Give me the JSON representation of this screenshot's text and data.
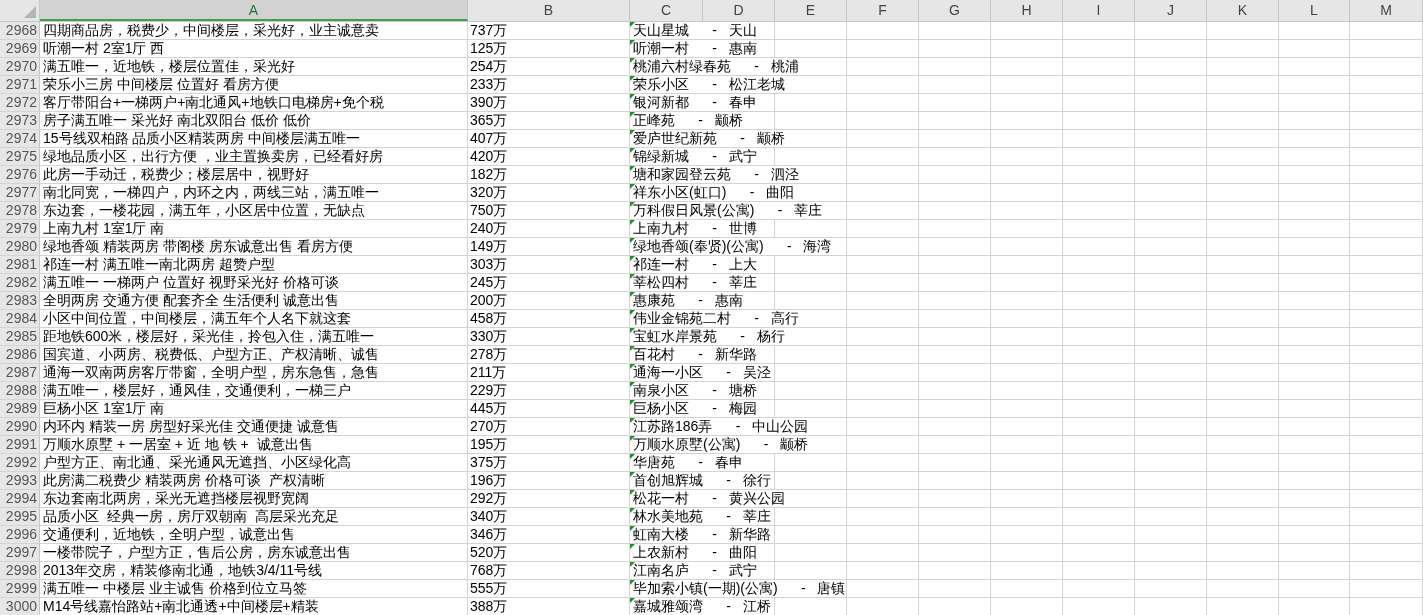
{
  "columns": [
    {
      "label": "A",
      "selected": true
    },
    {
      "label": "B",
      "selected": false
    },
    {
      "label": "C",
      "selected": false
    },
    {
      "label": "D",
      "selected": false
    },
    {
      "label": "E",
      "selected": false
    },
    {
      "label": "F",
      "selected": false
    },
    {
      "label": "G",
      "selected": false
    },
    {
      "label": "H",
      "selected": false
    },
    {
      "label": "I",
      "selected": false
    },
    {
      "label": "J",
      "selected": false
    },
    {
      "label": "K",
      "selected": false
    },
    {
      "label": "L",
      "selected": false
    },
    {
      "label": "M",
      "selected": false
    }
  ],
  "rows": [
    {
      "number": "2968",
      "a": "四期商品房，税费少，中间楼层，采光好，业主诚意卖",
      "b": "737万",
      "c": "天山星城      -   天山"
    },
    {
      "number": "2969",
      "a": "听潮一村 2室1厅 西",
      "b": "125万",
      "c": "听潮一村      -   惠南"
    },
    {
      "number": "2970",
      "a": "满五唯一，近地铁，楼层位置佳，采光好",
      "b": "254万",
      "c": "桃浦六村绿春苑      -   桃浦"
    },
    {
      "number": "2971",
      "a": "荣乐小三房 中间楼层 位置好 看房方便",
      "b": "233万",
      "c": "荣乐小区      -   松江老城"
    },
    {
      "number": "2972",
      "a": "客厅带阳台+一梯两户+南北通风+地铁口电梯房+免个税",
      "b": "390万",
      "c": "银河新都      -   春申"
    },
    {
      "number": "2973",
      "a": "房子满五唯一 采光好 南北双阳台 低价 低价",
      "b": "365万",
      "c": "正峰苑      -   颛桥"
    },
    {
      "number": "2974",
      "a": "15号线双柏路 品质小区精装两房 中间楼层满五唯一",
      "b": "407万",
      "c": "爱庐世纪新苑      -   颛桥"
    },
    {
      "number": "2975",
      "a": "绿地品质小区，出行方便 ，业主置换卖房，已经看好房",
      "b": "420万",
      "c": "锦绿新城      -   武宁"
    },
    {
      "number": "2976",
      "a": "此房一手动迁，税费少；楼层居中，视野好",
      "b": "182万",
      "c": "塘和家园登云苑      -   泗泾"
    },
    {
      "number": "2977",
      "a": "南北同宽，一梯四户，内环之内，两线三站，满五唯一",
      "b": "320万",
      "c": "祥东小区(虹口)      -   曲阳"
    },
    {
      "number": "2978",
      "a": "东边套，一楼花园，满五年，小区居中位置，无缺点",
      "b": "750万",
      "c": "万科假日风景(公寓)      -   莘庄"
    },
    {
      "number": "2979",
      "a": "上南九村 1室1厅 南",
      "b": "240万",
      "c": "上南九村      -   世博"
    },
    {
      "number": "2980",
      "a": "绿地香颂 精装两房 带阁楼 房东诚意出售 看房方便",
      "b": "149万",
      "c": "绿地香颂(奉贤)(公寓)      -   海湾"
    },
    {
      "number": "2981",
      "a": "祁连一村 满五唯一南北两房 超赞户型",
      "b": "303万",
      "c": "祁连一村      -   上大"
    },
    {
      "number": "2982",
      "a": "满五唯一 一梯两户 位置好 视野采光好 价格可谈",
      "b": "245万",
      "c": "莘松四村      -   莘庄"
    },
    {
      "number": "2983",
      "a": "全明两房 交通方便 配套齐全 生活便利 诚意出售",
      "b": "200万",
      "c": "惠康苑      -   惠南"
    },
    {
      "number": "2984",
      "a": "小区中间位置，中间楼层，满五年个人名下就这套",
      "b": "458万",
      "c": "伟业金锦苑二村      -   高行"
    },
    {
      "number": "2985",
      "a": "距地铁600米，楼层好，采光佳，拎包入住，满五唯一",
      "b": "330万",
      "c": "宝虹水岸景苑      -   杨行"
    },
    {
      "number": "2986",
      "a": "国宾道、小两房、税费低、户型方正、产权清晰、诚售",
      "b": "278万",
      "c": "百花村      -   新华路"
    },
    {
      "number": "2987",
      "a": "通海一双南两房客厅带窗，全明户型，房东急售，急售",
      "b": "211万",
      "c": "通海一小区      -   吴泾"
    },
    {
      "number": "2988",
      "a": "满五唯一，楼层好，通风佳，交通便利，一梯三户",
      "b": "229万",
      "c": "南泉小区      -   塘桥"
    },
    {
      "number": "2989",
      "a": "巨杨小区 1室1厅 南",
      "b": "445万",
      "c": "巨杨小区      -   梅园"
    },
    {
      "number": "2990",
      "a": "内环内 精装一房 房型好采光佳 交通便捷 诚意售",
      "b": "270万",
      "c": "江苏路186弄      -   中山公园"
    },
    {
      "number": "2991",
      "a": "万顺水原墅 + 一居室 + 近 地 铁 +  诚意出售",
      "b": "195万",
      "c": "万顺水原墅(公寓)      -   颛桥"
    },
    {
      "number": "2992",
      "a": "户型方正、南北通、采光通风无遮挡、小区绿化高",
      "b": "375万",
      "c": "华唐苑      -   春申"
    },
    {
      "number": "2993",
      "a": "此房满二税费少 精装两房 价格可谈  产权清晰",
      "b": "196万",
      "c": "首创旭辉城      -   徐行"
    },
    {
      "number": "2994",
      "a": "东边套南北两房，采光无遮挡楼层视野宽阔",
      "b": "292万",
      "c": "松花一村      -   黄兴公园"
    },
    {
      "number": "2995",
      "a": "品质小区  经典一房，房厅双朝南  高层采光充足",
      "b": "340万",
      "c": "林水美地苑      -   莘庄"
    },
    {
      "number": "2996",
      "a": "交通便利，近地铁，全明户型，诚意出售",
      "b": "346万",
      "c": "虹南大楼      -   新华路"
    },
    {
      "number": "2997",
      "a": "一楼带院子，户型方正，售后公房，房东诚意出售",
      "b": "520万",
      "c": "上农新村      -   曲阳"
    },
    {
      "number": "2998",
      "a": "2013年交房，精装修南北通，地铁3/4/11号线",
      "b": "768万",
      "c": "江南名庐      -   武宁"
    },
    {
      "number": "2999",
      "a": "满五唯一 中楼层 业主诚售 价格到位立马签",
      "b": "555万",
      "c": "毕加索小镇(一期)(公寓)      -   唐镇"
    },
    {
      "number": "3000",
      "a": "M14号线嘉怡路站+南北通透+中间楼层+精装",
      "b": "388万",
      "c": "嘉城雅颂湾      -   江桥"
    }
  ]
}
